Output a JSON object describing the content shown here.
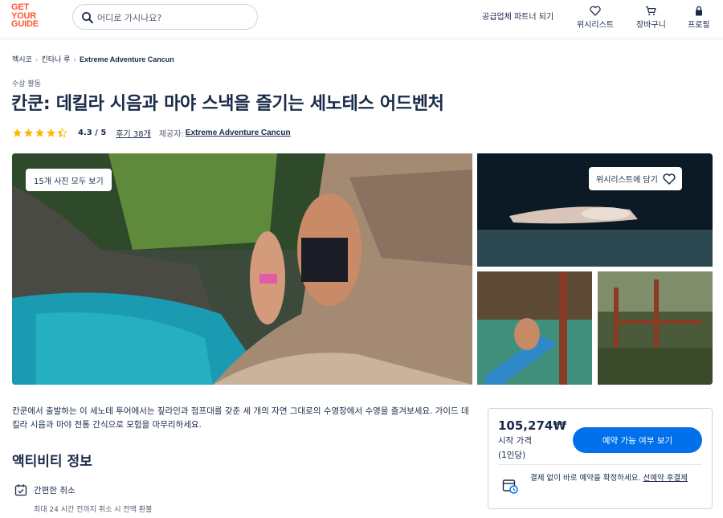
{
  "header": {
    "logo_lines": [
      "GET",
      "YOUR",
      "GUIDE"
    ],
    "search_placeholder": "어디로 가시나요?",
    "supplier_link": "공급업체 파트너 되기",
    "nav": [
      {
        "label": "위시리스트",
        "icon": "heart-icon"
      },
      {
        "label": "장바구니",
        "icon": "cart-icon"
      },
      {
        "label": "프로필",
        "icon": "profile-icon"
      }
    ]
  },
  "breadcrumb": [
    "멕시코",
    "킨타나 루",
    "Extreme Adventure Cancun"
  ],
  "activity": {
    "category": "수상 활동",
    "title": "칸쿤: 데킬라 시음과 마야 스낵을 즐기는 세노테스 어드벤처",
    "rating_stars": 4.3,
    "rating_text": "4.3 / 5",
    "reviews": "후기 38개",
    "provider_label": "제공자:",
    "provider": "Extreme Adventure Cancun"
  },
  "gallery": {
    "view_all": "15개 사진 모두 보기",
    "wishlist": "위시리스트에 담기"
  },
  "description": "칸쿤에서 출발하는 이 세노테 투어에서는 짚라인과 점프대를 갖춘 세 개의 자연 그대로의 수영장에서 수영을 즐겨보세요. 가이드 데킬라 시음과 마야 전통 간식으로 모험을 마무리하세요.",
  "about": {
    "title": "액티비티 정보",
    "feature_title": "간편한 취소",
    "feature_sub": "최대 24 시간 전까지 취소 시 전액 환불"
  },
  "booking": {
    "price": "105,274₩",
    "from": "시작 가격",
    "per": "(1인당)",
    "button": "예약 가능 여부 보기",
    "reserve_text": "결제 없이 바로 예약을 확정하세요. ",
    "reserve_link": "선예약 후결제"
  },
  "colors": {
    "brand": "#ff5533",
    "primary_button": "#0071eb",
    "star": "#ffb700",
    "text": "#1a2b49"
  }
}
